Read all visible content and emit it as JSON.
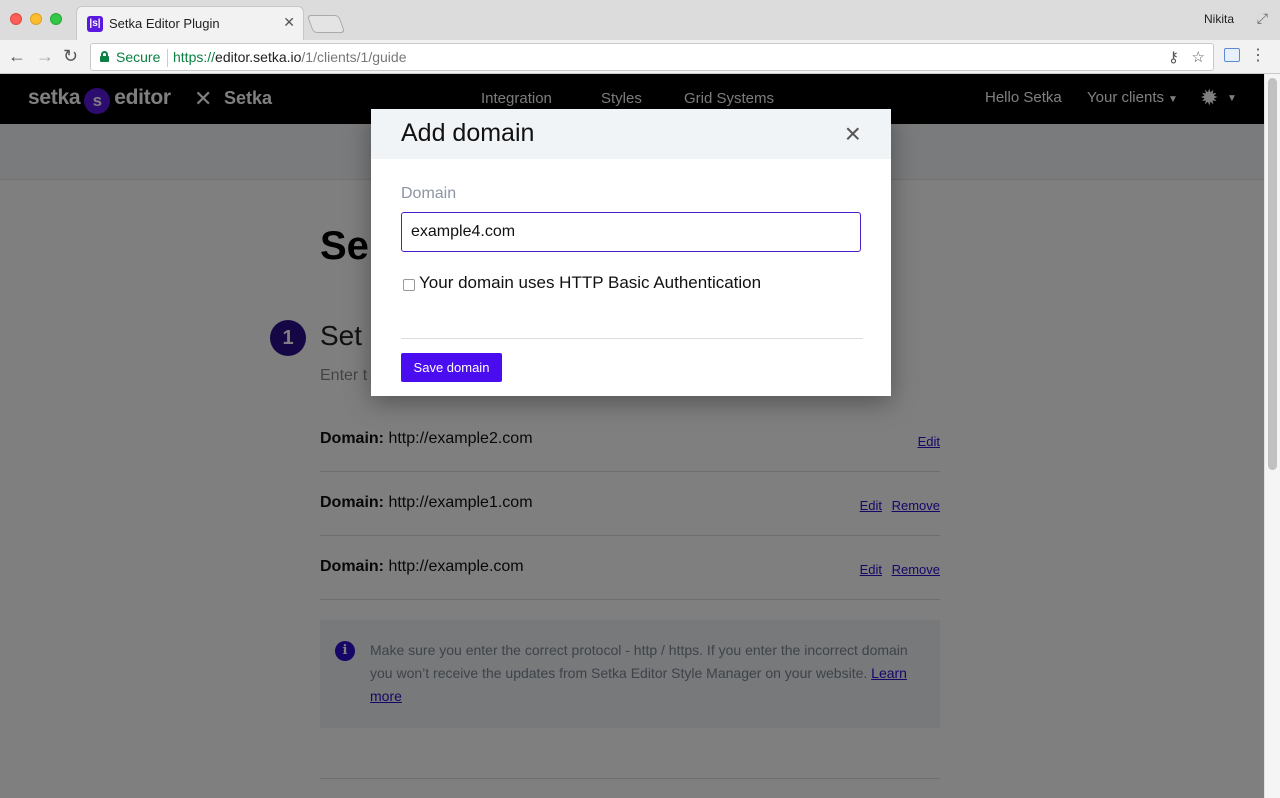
{
  "browser": {
    "tab_title": "Setka Editor Plugin",
    "favicon_text": "|s|",
    "tab_close": "✕",
    "profile_name": "Nikita",
    "secure_label": "Secure",
    "url_scheme": "https://",
    "url_host": "editor.setka.io",
    "url_path": "/1/clients/1/guide"
  },
  "appnav": {
    "logo_left": "setka",
    "logo_mark": "s",
    "logo_right": "editor",
    "x_mark": "✕",
    "partner": "Setka",
    "links": [
      "Integration",
      "Styles",
      "Grid Systems"
    ],
    "hello": "Hello Setka",
    "clients": "Your clients"
  },
  "page": {
    "heading_partial": "Se",
    "step_number": "1",
    "step_title_partial": "Set",
    "step_sub_partial": "Enter t",
    "domains": [
      {
        "label": "Domain:",
        "value": "http://example2.com",
        "actions": [
          "Edit"
        ]
      },
      {
        "label": "Domain:",
        "value": "http://example1.com",
        "actions": [
          "Edit",
          "Remove"
        ]
      },
      {
        "label": "Domain:",
        "value": "http://example.com",
        "actions": [
          "Edit",
          "Remove"
        ]
      }
    ],
    "info_text": "Make sure you enter the correct protocol - http / https. If you enter the incorrect domain you won’t receive the updates from Setka Editor Style Manager on your website.",
    "info_link": "Learn more"
  },
  "modal": {
    "title": "Add domain",
    "close": "×",
    "field_label": "Domain",
    "input_value": "example4.com",
    "checkbox_label": "Your domain uses HTTP Basic Authentication",
    "checkbox_checked": false,
    "save_label": "Save domain"
  },
  "colors": {
    "brand_purple": "#4a0df0",
    "step_circle": "#2a0c8c",
    "link": "#2a0cd0"
  }
}
